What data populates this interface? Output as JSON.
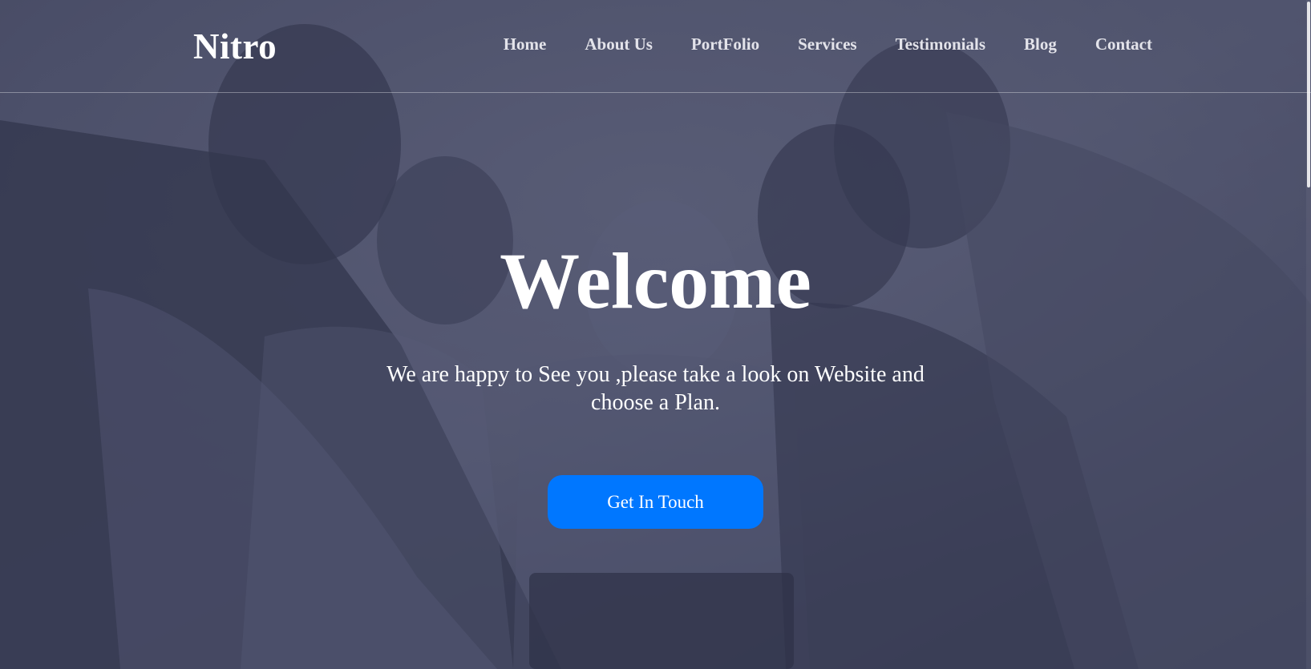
{
  "brand": {
    "name": "Nitro"
  },
  "nav": {
    "items": [
      {
        "label": "Home"
      },
      {
        "label": "About Us"
      },
      {
        "label": "PortFolio"
      },
      {
        "label": "Services"
      },
      {
        "label": "Testimonials"
      },
      {
        "label": "Blog"
      },
      {
        "label": "Contact"
      }
    ]
  },
  "hero": {
    "title": "Welcome",
    "subtitle": "We are happy to See you ,please take a look on Website and choose a Plan.",
    "cta_label": "Get In Touch"
  },
  "colors": {
    "accent": "#0077ff",
    "overlay": "#3a3e58",
    "text": "#ffffff"
  },
  "icons": {
    "background": "team-photo-image"
  }
}
